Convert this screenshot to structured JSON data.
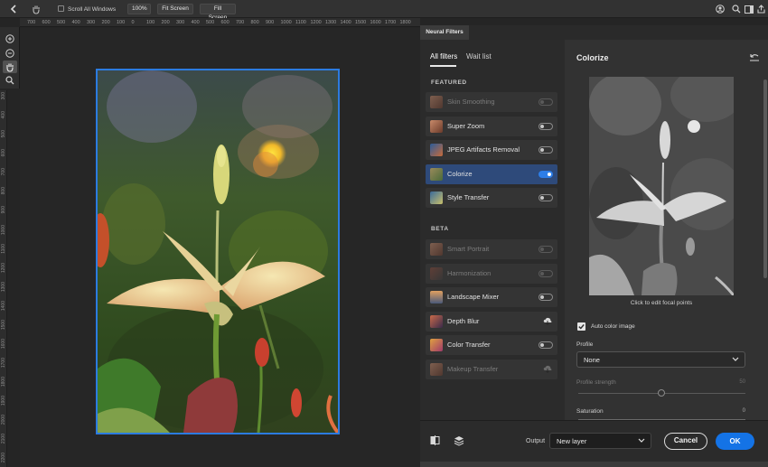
{
  "top_options": {
    "scroll_all_windows_label": "Scroll All Windows",
    "zoom_100_label": "100%",
    "fit_screen_label": "Fit Screen",
    "fill_screen_label": "Fill Screen"
  },
  "ruler": {
    "top_ticks": [
      "700",
      "600",
      "500",
      "400",
      "300",
      "200",
      "100",
      "0",
      "100",
      "200",
      "300",
      "400",
      "500",
      "600",
      "700",
      "800",
      "900",
      "1000",
      "1100",
      "1200",
      "1300",
      "1400",
      "1500",
      "1600",
      "1700",
      "1800"
    ],
    "left_ticks": [
      "300",
      "400",
      "500",
      "600",
      "700",
      "800",
      "900",
      "1000",
      "1100",
      "1200",
      "1300",
      "1400",
      "1500",
      "1600",
      "1700",
      "1800",
      "1900",
      "2000",
      "2100",
      "2200"
    ]
  },
  "panel": {
    "title": "Neural Filters",
    "tabs": {
      "all": "All filters",
      "wait": "Wait list"
    },
    "featured_header": "FEATURED",
    "beta_header": "BETA",
    "featured": [
      {
        "label": "Skin Smoothing",
        "state": "disabled",
        "thumb": "face-thumb"
      },
      {
        "label": "Super Zoom",
        "state": "off",
        "thumb": "face-thumb"
      },
      {
        "label": "JPEG Artifacts Removal",
        "state": "off",
        "thumb": "jpeg-thumb"
      },
      {
        "label": "Colorize",
        "state": "on",
        "thumb": "colorize-thumb"
      },
      {
        "label": "Style Transfer",
        "state": "off",
        "thumb": "style-thumb"
      }
    ],
    "beta": [
      {
        "label": "Smart Portrait",
        "state": "disabled",
        "thumb": "face-thumb"
      },
      {
        "label": "Harmonization",
        "state": "disabled",
        "thumb": "harmonize-thumb"
      },
      {
        "label": "Landscape Mixer",
        "state": "off",
        "thumb": "landscape-thumb"
      },
      {
        "label": "Depth Blur",
        "state": "cloud",
        "thumb": "depth-thumb"
      },
      {
        "label": "Color Transfer",
        "state": "off",
        "thumb": "color-transfer-thumb"
      },
      {
        "label": "Makeup Transfer",
        "state": "disabled-cloud",
        "thumb": "face-thumb"
      }
    ]
  },
  "colorize": {
    "title": "Colorize",
    "caption": "Click to edit focal points",
    "auto_color_label": "Auto color image",
    "auto_color_checked": true,
    "profile_label": "Profile",
    "profile_value": "None",
    "profile_strength_label": "Profile strength",
    "profile_strength_value": "50",
    "saturation_label": "Saturation",
    "saturation_value": "0"
  },
  "bottom": {
    "output_label": "Output",
    "output_value": "New layer",
    "cancel_label": "Cancel",
    "ok_label": "OK"
  },
  "colors": {
    "accent": "#1473e6",
    "selection": "#2c7be0",
    "selected_row": "#2e4a7a"
  }
}
